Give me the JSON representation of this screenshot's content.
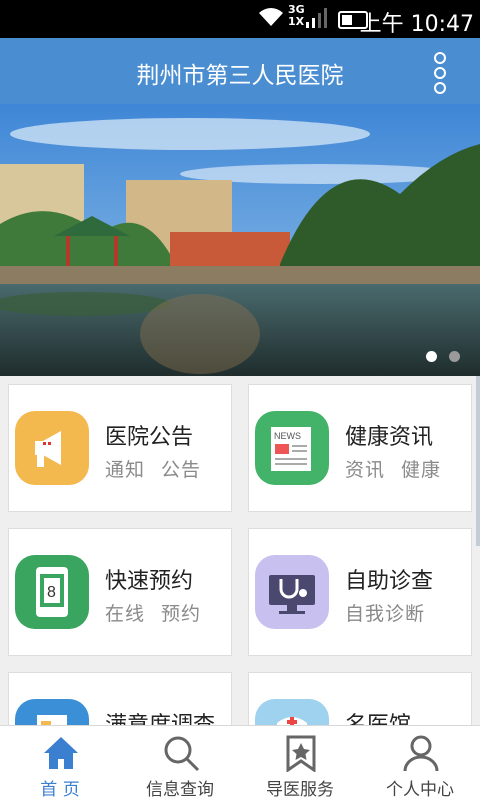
{
  "status": {
    "network": "3G",
    "network2": "1X",
    "time": "上午 10:47"
  },
  "header": {
    "title": "荆州市第三人民医院"
  },
  "banner": {
    "pages": 2,
    "active_page": 1
  },
  "cards": [
    {
      "title": "医院公告",
      "tags": [
        "通知",
        "公告"
      ]
    },
    {
      "title": "健康资讯",
      "tags": [
        "资讯",
        "健康"
      ],
      "badge": "NEWS"
    },
    {
      "title": "快速预约",
      "tags": [
        "在线",
        "预约"
      ],
      "number": "8"
    },
    {
      "title": "自助诊查",
      "tags": [
        "自我诊断"
      ]
    },
    {
      "title": "满意度调查",
      "tags": []
    },
    {
      "title": "名医馆",
      "tags": []
    }
  ],
  "tabs": [
    {
      "label": "首  页",
      "active": true
    },
    {
      "label": "信息查询",
      "active": false
    },
    {
      "label": "导医服务",
      "active": false
    },
    {
      "label": "个人中心",
      "active": false
    }
  ]
}
